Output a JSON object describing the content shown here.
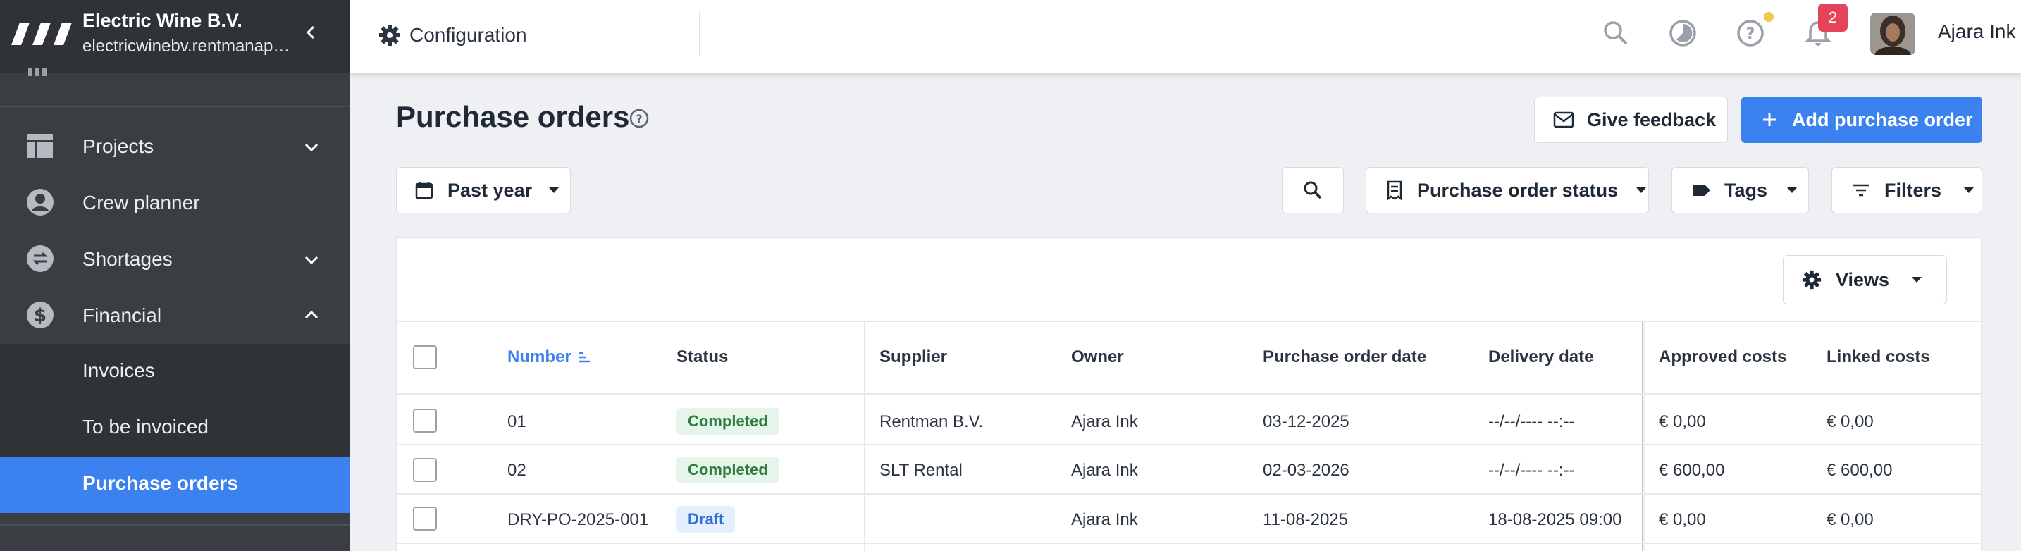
{
  "colors": {
    "accent": "#3b82f0",
    "sidebar_bg": "#3a3d42",
    "badge": "#e4445a",
    "completed": "#2e7d45",
    "draft": "#2f6fd6"
  },
  "sidebar": {
    "company": "Electric Wine B.V.",
    "domain": "electricwinebv.rentmanap…",
    "items": [
      {
        "label": "Projects",
        "icon": "table-icon",
        "chevron": "down"
      },
      {
        "label": "Crew planner",
        "icon": "person-icon"
      },
      {
        "label": "Shortages",
        "icon": "swap-icon",
        "chevron": "down"
      },
      {
        "label": "Financial",
        "icon": "dollar-icon",
        "chevron": "up"
      }
    ],
    "subitems": [
      {
        "label": "Invoices"
      },
      {
        "label": "To be invoiced"
      },
      {
        "label": "Purchase orders",
        "active": true
      }
    ]
  },
  "topbar": {
    "configuration": "Configuration",
    "notifications_count": "2",
    "user_name": "Ajara Ink"
  },
  "page": {
    "title": "Purchase orders",
    "give_feedback": "Give feedback",
    "add_purchase_order": "Add purchase order"
  },
  "filters": {
    "period": "Past year",
    "status": "Purchase order status",
    "tags": "Tags",
    "filters": "Filters",
    "views": "Views"
  },
  "table": {
    "columns": [
      "Number",
      "Status",
      "Supplier",
      "Owner",
      "Purchase order date",
      "Delivery date",
      "Approved costs",
      "Linked costs"
    ],
    "rows": [
      {
        "number": "01",
        "status": "Completed",
        "supplier": "Rentman B.V.",
        "owner": "Ajara Ink",
        "po_date": "03-12-2025",
        "delivery": "--/--/---- --:--",
        "approved": "€ 0,00",
        "linked": "€ 0,00"
      },
      {
        "number": "02",
        "status": "Completed",
        "supplier": "SLT Rental",
        "owner": "Ajara Ink",
        "po_date": "02-03-2026",
        "delivery": "--/--/---- --:--",
        "approved": "€ 600,00",
        "linked": "€ 600,00"
      },
      {
        "number": "DRY-PO-2025-001",
        "status": "Draft",
        "supplier": "",
        "owner": "Ajara Ink",
        "po_date": "11-08-2025",
        "delivery": "18-08-2025 09:00",
        "approved": "€ 0,00",
        "linked": "€ 0,00"
      }
    ]
  }
}
